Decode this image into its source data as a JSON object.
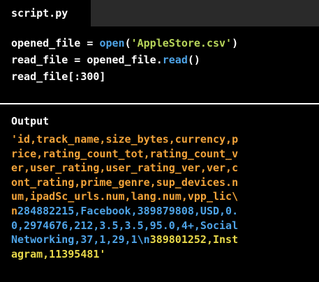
{
  "tab": {
    "label": "script.py"
  },
  "code": {
    "line1": {
      "a": "opened_file = ",
      "fn": "open",
      "b": "(",
      "str": "'AppleStore.csv'",
      "c": ")"
    },
    "line2": {
      "a": "read_file = opened_file.",
      "fn": "read",
      "b": "()"
    },
    "line3": {
      "a": "read_file[:300]"
    }
  },
  "output": {
    "label": "Output",
    "lines": [
      [
        {
          "text": "'id,track_name,size_bytes,currency,p",
          "color": "y"
        }
      ],
      [
        {
          "text": "rice,rating_count_tot,rating_count_v",
          "color": "y"
        }
      ],
      [
        {
          "text": "er,user_rating,user_rating_ver,ver,c",
          "color": "y"
        }
      ],
      [
        {
          "text": "ont_rating,prime_genre,sup_devices.n",
          "color": "y"
        }
      ],
      [
        {
          "text": "um,ipadSc_urls.num,lang.num,vpp_lic\\",
          "color": "y"
        }
      ],
      [
        {
          "text": "n",
          "color": "y"
        },
        {
          "text": "284882215,Facebook,389879808,USD,0.",
          "color": "b"
        }
      ],
      [
        {
          "text": "0,2974676,212,3.5,3.5,95.0,4+,Social",
          "color": "b"
        }
      ],
      [
        {
          "text": "Networking,37,1,29,1\\n",
          "color": "b"
        },
        {
          "text": "389801252,Inst",
          "color": "g"
        }
      ],
      [
        {
          "text": "agram,11395481'",
          "color": "g"
        }
      ]
    ]
  },
  "colors": {
    "function": "#4ea3e6",
    "string": "#b8d65a",
    "output_header": "#f2a33a",
    "output_row1": "#4ea3e6",
    "output_row2": "#e8d84a"
  }
}
